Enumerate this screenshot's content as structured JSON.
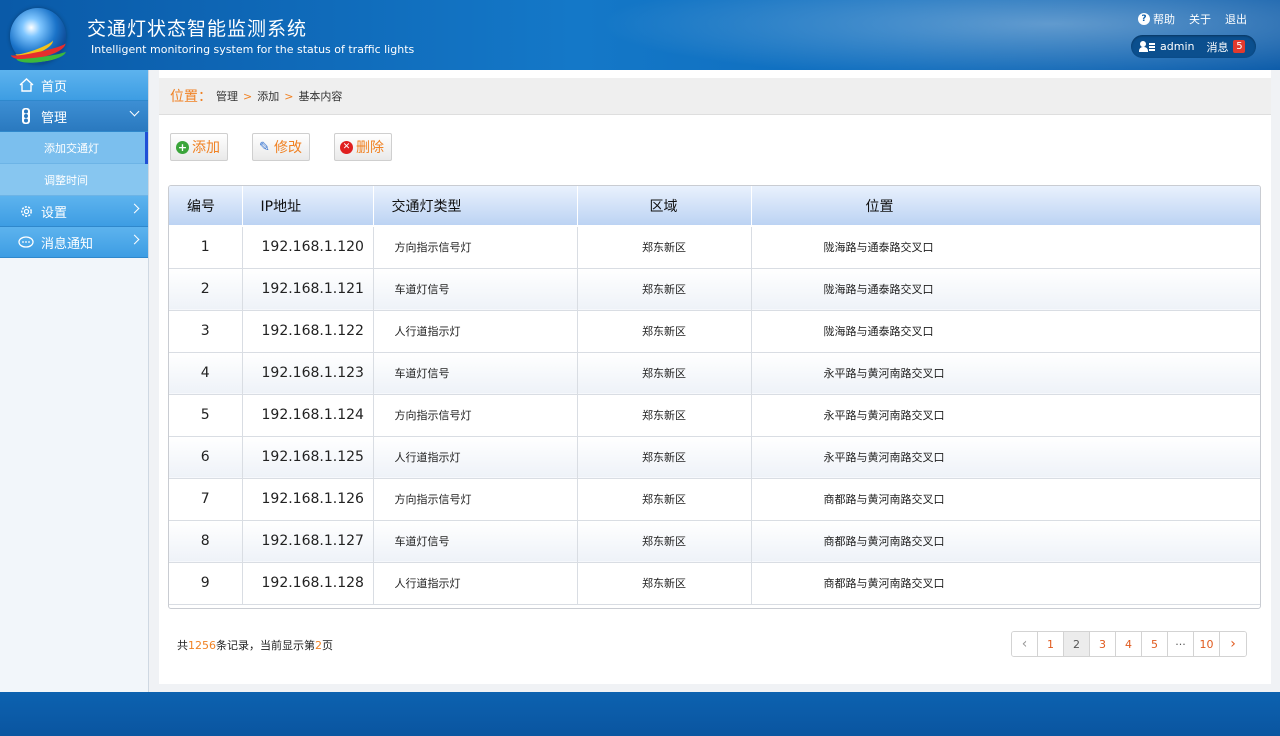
{
  "header": {
    "title_cn": "交通灯状态智能监测系统",
    "title_en": "Intelligent monitoring system for the status of traffic lights",
    "links": {
      "help": "帮助",
      "about": "关于",
      "logout": "退出"
    },
    "user": {
      "name": "admin",
      "messages_label": "消息",
      "messages_count": "5"
    }
  },
  "sidebar": {
    "home": "首页",
    "manage": "管理",
    "manage_sub": [
      "添加交通灯",
      "调整时间"
    ],
    "settings": "设置",
    "notifications": "消息通知"
  },
  "breadcrumb": {
    "label": "位置：",
    "items": [
      "管理",
      "添加",
      "基本内容"
    ]
  },
  "toolbar": {
    "add": "添加",
    "edit": "修改",
    "delete": "删除"
  },
  "table": {
    "headers": [
      "编号",
      "IP地址",
      "交通灯类型",
      "区域",
      "位置"
    ],
    "rows": [
      {
        "no": "1",
        "ip": "192.168.1.120",
        "type": "方向指示信号灯",
        "area": "郑东新区",
        "loc": "陇海路与通泰路交叉口"
      },
      {
        "no": "2",
        "ip": "192.168.1.121",
        "type": "车道灯信号",
        "area": "郑东新区",
        "loc": "陇海路与通泰路交叉口"
      },
      {
        "no": "3",
        "ip": "192.168.1.122",
        "type": "人行道指示灯",
        "area": "郑东新区",
        "loc": "陇海路与通泰路交叉口"
      },
      {
        "no": "4",
        "ip": "192.168.1.123",
        "type": "车道灯信号",
        "area": "郑东新区",
        "loc": "永平路与黄河南路交叉口"
      },
      {
        "no": "5",
        "ip": "192.168.1.124",
        "type": "方向指示信号灯",
        "area": "郑东新区",
        "loc": "永平路与黄河南路交叉口"
      },
      {
        "no": "6",
        "ip": "192.168.1.125",
        "type": "人行道指示灯",
        "area": "郑东新区",
        "loc": "永平路与黄河南路交叉口"
      },
      {
        "no": "7",
        "ip": "192.168.1.126",
        "type": "方向指示信号灯",
        "area": "郑东新区",
        "loc": "商都路与黄河南路交叉口"
      },
      {
        "no": "8",
        "ip": "192.168.1.127",
        "type": "车道灯信号",
        "area": "郑东新区",
        "loc": "商都路与黄河南路交叉口"
      },
      {
        "no": "9",
        "ip": "192.168.1.128",
        "type": "人行道指示灯",
        "area": "郑东新区",
        "loc": "商都路与黄河南路交叉口"
      }
    ]
  },
  "footer": {
    "prefix": "共",
    "total": "1256",
    "middle": "条记录，当前显示第",
    "page": "2",
    "suffix": "页"
  },
  "pager": {
    "pages": [
      "1",
      "2",
      "3",
      "4",
      "5",
      "···",
      "10"
    ],
    "prev": "‹",
    "next": "›"
  }
}
